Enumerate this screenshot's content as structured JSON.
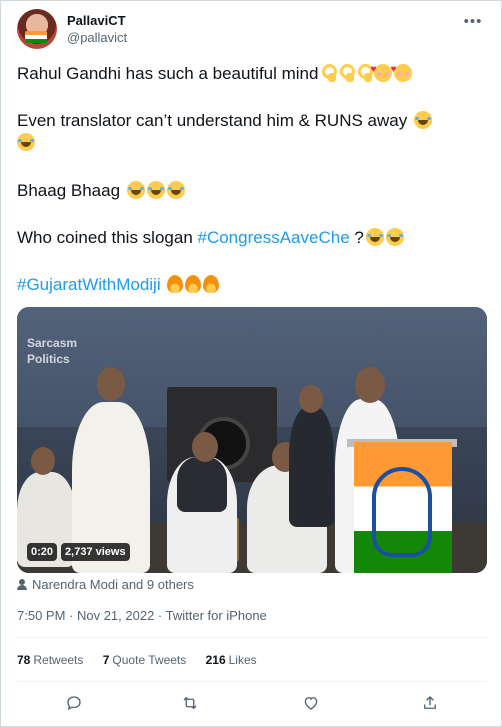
{
  "user": {
    "display_name": "PallaviCT",
    "handle": "@pallavict"
  },
  "tweet": {
    "line1": "Rahul Gandhi has such a beautiful mind",
    "line2": "Even translator can’t understand him & RUNS away",
    "line3": "Bhaag Bhaag",
    "line4_text": "Who coined this slogan ",
    "line4_hashtag": "#CongressAaveChe",
    "line4_after": " ?",
    "line5_hashtag": "#GujaratWithModiji"
  },
  "media": {
    "watermark_line1": "Sarcasm",
    "watermark_line2": "Politics",
    "duration": "0:20",
    "views": "2,737 views"
  },
  "tagged_people": "Narendra Modi and 9 others",
  "timestamp": "7:50 PM · Nov 21, 2022 · Twitter for iPhone",
  "stats": {
    "retweets_count": "78",
    "retweets_label": "Retweets",
    "quotes_count": "7",
    "quotes_label": "Quote Tweets",
    "likes_count": "216",
    "likes_label": "Likes"
  },
  "icons": {
    "more": "more-icon",
    "reply": "reply-icon",
    "retweet": "retweet-icon",
    "like": "heart-icon",
    "share": "share-icon"
  },
  "colors": {
    "link": "#1d9bf0",
    "text": "#0f1419",
    "secondary": "#536471"
  }
}
